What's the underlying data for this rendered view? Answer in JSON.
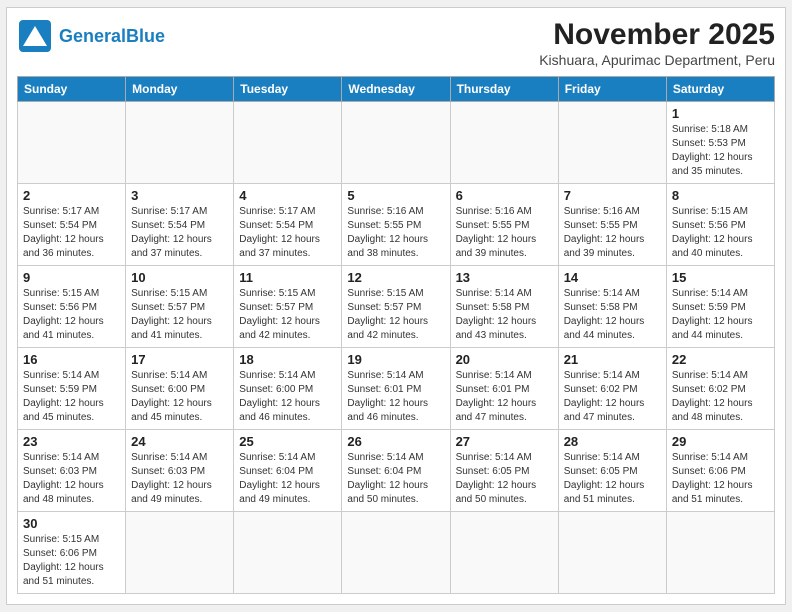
{
  "header": {
    "logo_general": "General",
    "logo_blue": "Blue",
    "month_year": "November 2025",
    "location": "Kishuara, Apurimac Department, Peru"
  },
  "weekdays": [
    "Sunday",
    "Monday",
    "Tuesday",
    "Wednesday",
    "Thursday",
    "Friday",
    "Saturday"
  ],
  "weeks": [
    [
      {
        "day": "",
        "info": ""
      },
      {
        "day": "",
        "info": ""
      },
      {
        "day": "",
        "info": ""
      },
      {
        "day": "",
        "info": ""
      },
      {
        "day": "",
        "info": ""
      },
      {
        "day": "",
        "info": ""
      },
      {
        "day": "1",
        "info": "Sunrise: 5:18 AM\nSunset: 5:53 PM\nDaylight: 12 hours\nand 35 minutes."
      }
    ],
    [
      {
        "day": "2",
        "info": "Sunrise: 5:17 AM\nSunset: 5:54 PM\nDaylight: 12 hours\nand 36 minutes."
      },
      {
        "day": "3",
        "info": "Sunrise: 5:17 AM\nSunset: 5:54 PM\nDaylight: 12 hours\nand 37 minutes."
      },
      {
        "day": "4",
        "info": "Sunrise: 5:17 AM\nSunset: 5:54 PM\nDaylight: 12 hours\nand 37 minutes."
      },
      {
        "day": "5",
        "info": "Sunrise: 5:16 AM\nSunset: 5:55 PM\nDaylight: 12 hours\nand 38 minutes."
      },
      {
        "day": "6",
        "info": "Sunrise: 5:16 AM\nSunset: 5:55 PM\nDaylight: 12 hours\nand 39 minutes."
      },
      {
        "day": "7",
        "info": "Sunrise: 5:16 AM\nSunset: 5:55 PM\nDaylight: 12 hours\nand 39 minutes."
      },
      {
        "day": "8",
        "info": "Sunrise: 5:15 AM\nSunset: 5:56 PM\nDaylight: 12 hours\nand 40 minutes."
      }
    ],
    [
      {
        "day": "9",
        "info": "Sunrise: 5:15 AM\nSunset: 5:56 PM\nDaylight: 12 hours\nand 41 minutes."
      },
      {
        "day": "10",
        "info": "Sunrise: 5:15 AM\nSunset: 5:57 PM\nDaylight: 12 hours\nand 41 minutes."
      },
      {
        "day": "11",
        "info": "Sunrise: 5:15 AM\nSunset: 5:57 PM\nDaylight: 12 hours\nand 42 minutes."
      },
      {
        "day": "12",
        "info": "Sunrise: 5:15 AM\nSunset: 5:57 PM\nDaylight: 12 hours\nand 42 minutes."
      },
      {
        "day": "13",
        "info": "Sunrise: 5:14 AM\nSunset: 5:58 PM\nDaylight: 12 hours\nand 43 minutes."
      },
      {
        "day": "14",
        "info": "Sunrise: 5:14 AM\nSunset: 5:58 PM\nDaylight: 12 hours\nand 44 minutes."
      },
      {
        "day": "15",
        "info": "Sunrise: 5:14 AM\nSunset: 5:59 PM\nDaylight: 12 hours\nand 44 minutes."
      }
    ],
    [
      {
        "day": "16",
        "info": "Sunrise: 5:14 AM\nSunset: 5:59 PM\nDaylight: 12 hours\nand 45 minutes."
      },
      {
        "day": "17",
        "info": "Sunrise: 5:14 AM\nSunset: 6:00 PM\nDaylight: 12 hours\nand 45 minutes."
      },
      {
        "day": "18",
        "info": "Sunrise: 5:14 AM\nSunset: 6:00 PM\nDaylight: 12 hours\nand 46 minutes."
      },
      {
        "day": "19",
        "info": "Sunrise: 5:14 AM\nSunset: 6:01 PM\nDaylight: 12 hours\nand 46 minutes."
      },
      {
        "day": "20",
        "info": "Sunrise: 5:14 AM\nSunset: 6:01 PM\nDaylight: 12 hours\nand 47 minutes."
      },
      {
        "day": "21",
        "info": "Sunrise: 5:14 AM\nSunset: 6:02 PM\nDaylight: 12 hours\nand 47 minutes."
      },
      {
        "day": "22",
        "info": "Sunrise: 5:14 AM\nSunset: 6:02 PM\nDaylight: 12 hours\nand 48 minutes."
      }
    ],
    [
      {
        "day": "23",
        "info": "Sunrise: 5:14 AM\nSunset: 6:03 PM\nDaylight: 12 hours\nand 48 minutes."
      },
      {
        "day": "24",
        "info": "Sunrise: 5:14 AM\nSunset: 6:03 PM\nDaylight: 12 hours\nand 49 minutes."
      },
      {
        "day": "25",
        "info": "Sunrise: 5:14 AM\nSunset: 6:04 PM\nDaylight: 12 hours\nand 49 minutes."
      },
      {
        "day": "26",
        "info": "Sunrise: 5:14 AM\nSunset: 6:04 PM\nDaylight: 12 hours\nand 50 minutes."
      },
      {
        "day": "27",
        "info": "Sunrise: 5:14 AM\nSunset: 6:05 PM\nDaylight: 12 hours\nand 50 minutes."
      },
      {
        "day": "28",
        "info": "Sunrise: 5:14 AM\nSunset: 6:05 PM\nDaylight: 12 hours\nand 51 minutes."
      },
      {
        "day": "29",
        "info": "Sunrise: 5:14 AM\nSunset: 6:06 PM\nDaylight: 12 hours\nand 51 minutes."
      }
    ],
    [
      {
        "day": "30",
        "info": "Sunrise: 5:15 AM\nSunset: 6:06 PM\nDaylight: 12 hours\nand 51 minutes."
      },
      {
        "day": "",
        "info": ""
      },
      {
        "day": "",
        "info": ""
      },
      {
        "day": "",
        "info": ""
      },
      {
        "day": "",
        "info": ""
      },
      {
        "day": "",
        "info": ""
      },
      {
        "day": "",
        "info": ""
      }
    ]
  ]
}
